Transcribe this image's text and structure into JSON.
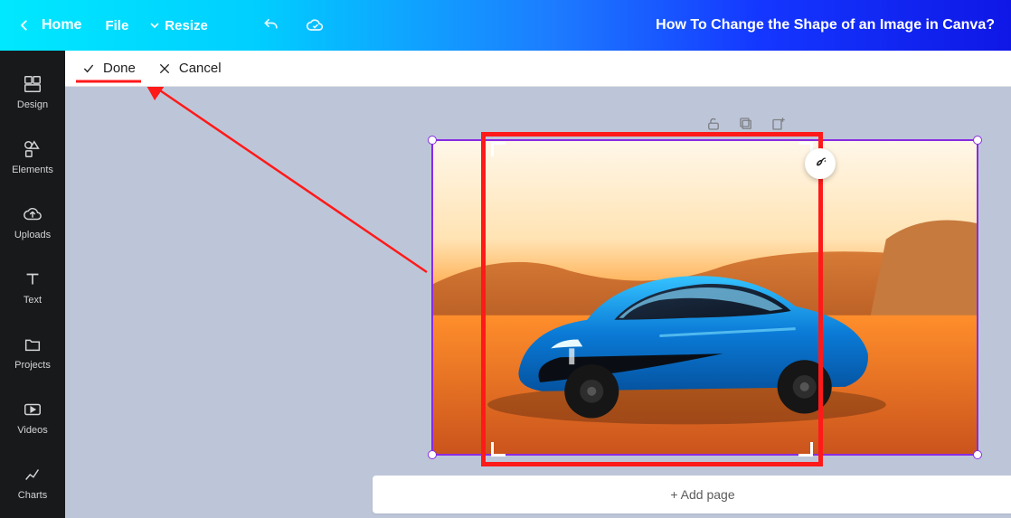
{
  "topbar": {
    "home": "Home",
    "file": "File",
    "resize": "Resize",
    "title": "How To Change the Shape of an Image in Canva?"
  },
  "cropbar": {
    "done": "Done",
    "cancel": "Cancel"
  },
  "sidebar": {
    "items": [
      {
        "label": "Design"
      },
      {
        "label": "Elements"
      },
      {
        "label": "Uploads"
      },
      {
        "label": "Text"
      },
      {
        "label": "Projects"
      },
      {
        "label": "Videos"
      },
      {
        "label": "Charts"
      }
    ]
  },
  "canvas": {
    "add_page": "+ Add page"
  },
  "selection": {
    "brand_accent": "#8a2be2",
    "annotation_red": "#ff1a1a"
  }
}
